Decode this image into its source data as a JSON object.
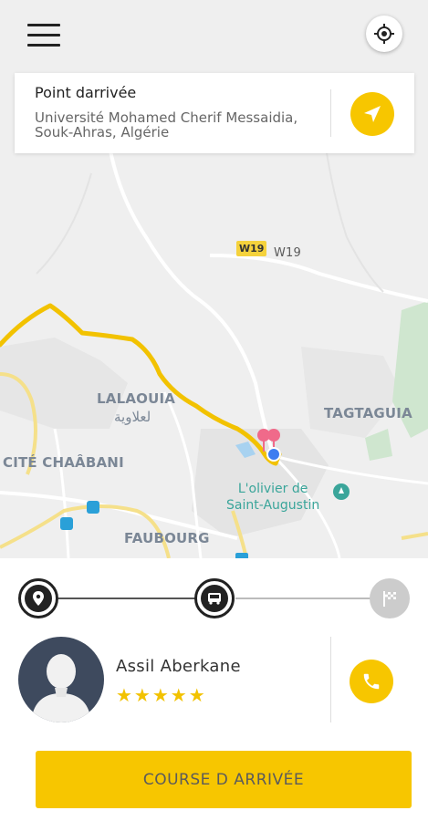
{
  "destination": {
    "title": "Point darrivée",
    "address": "Université Mohamed Cherif Messaidia, Souk-Ahras, Algérie"
  },
  "map": {
    "road_shield": "W19",
    "road_label": "W19",
    "labels": {
      "lalaouia": "LALAOUIA",
      "lalaouia_ar": "لعلاوية",
      "tagtaguia": "TAGTAGUIA",
      "cite_chaabani": "CITÉ CHAÂBANI",
      "faubourg": "FAUBOURG"
    },
    "poi": "L'olivier de\nSaint-Augustin"
  },
  "progress": {
    "steps": [
      {
        "icon": "map-pin-icon",
        "state": "done"
      },
      {
        "icon": "bus-icon",
        "state": "done"
      },
      {
        "icon": "checkered-flag-icon",
        "state": "pending"
      }
    ]
  },
  "driver": {
    "name": "Assil Aberkane",
    "rating_stars": "★★★★★",
    "rating": 5
  },
  "actions": {
    "main_button": "COURSE D ARRIVÉE"
  },
  "colors": {
    "accent": "#f7c600",
    "route": "#f2c200",
    "avatar_bg": "#3e4a5e",
    "poi": "#3aa59a",
    "map_label": "#7b8796"
  }
}
